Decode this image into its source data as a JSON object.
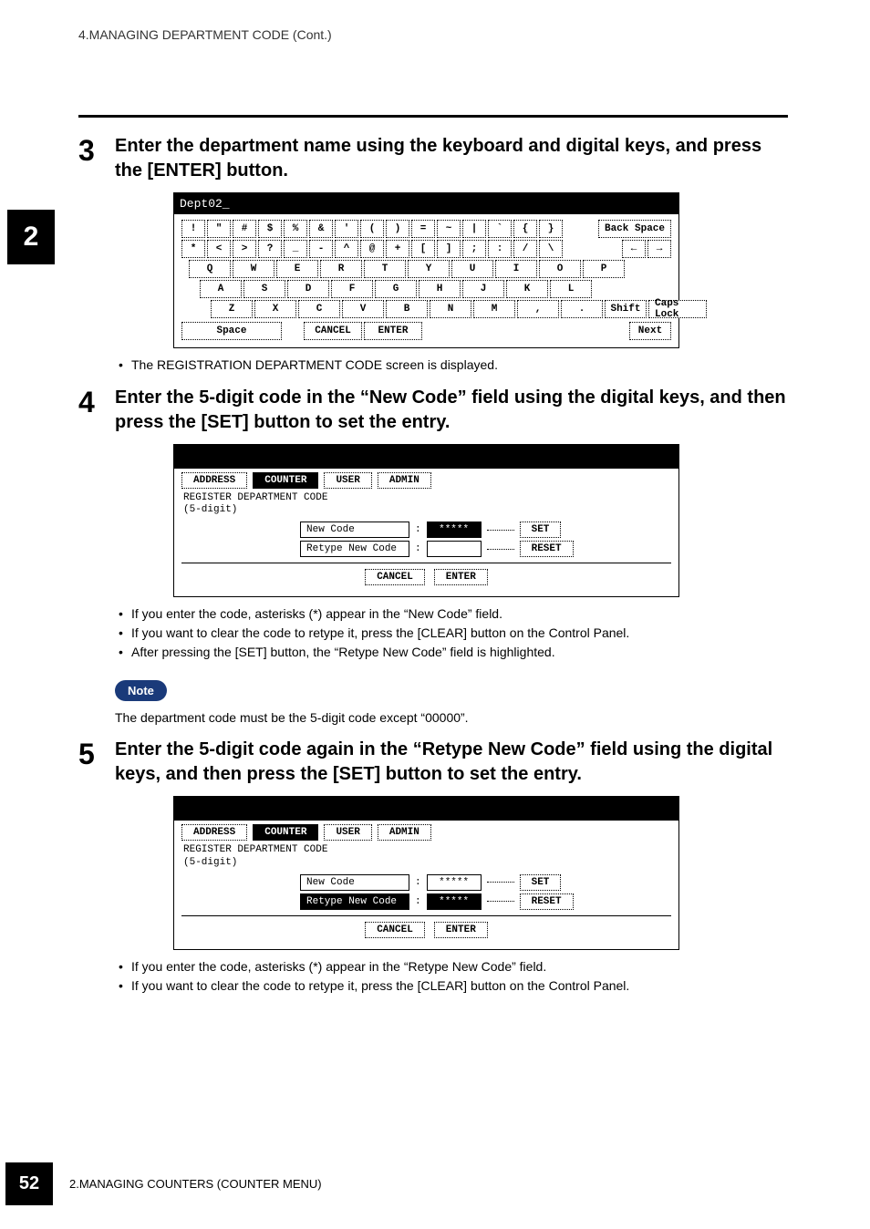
{
  "header_text": "4.MANAGING DEPARTMENT CODE (Cont.)",
  "side_tab": "2",
  "page_number": "52",
  "footer_text": "2.MANAGING COUNTERS (COUNTER MENU)",
  "steps": {
    "s3": {
      "num": "3",
      "heading": "Enter the department name using the keyboard and digital keys, and press the [ENTER] button.",
      "bullets": [
        "The REGISTRATION DEPARTMENT CODE screen is displayed."
      ]
    },
    "s4": {
      "num": "4",
      "heading": "Enter the 5-digit code in the “New Code” field using the digital keys, and then press the [SET] button to set the entry.",
      "bullets": [
        "If you enter the code, asterisks (*) appear in the “New Code” field.",
        "If you want to clear the code to retype it, press the [CLEAR] button on the Control Panel.",
        "After pressing the [SET] button, the “Retype New Code” field is highlighted."
      ]
    },
    "s5": {
      "num": "5",
      "heading": "Enter the 5-digit code again in the “Retype New Code” field using the digital keys, and then press the [SET] button to set the entry.",
      "bullets": [
        "If you enter the code, asterisks (*) appear in the “Retype New Code” field.",
        "If you want to clear the code to retype it, press the [CLEAR] button on the Control Panel."
      ]
    }
  },
  "note_label": "Note",
  "note_body": "The department code must be the 5-digit code except “00000”.",
  "keyboard": {
    "input_value": "Dept02_",
    "rows": {
      "r1": [
        "!",
        "\"",
        "#",
        "$",
        "%",
        "&",
        "'",
        "(",
        ")",
        "=",
        "~",
        "|",
        "`",
        "{",
        "}"
      ],
      "r2": [
        "*",
        "<",
        ">",
        "?",
        "_",
        "-",
        "^",
        "@",
        "+",
        "[",
        "]",
        ";",
        ":",
        "/",
        "\\"
      ],
      "r3": [
        "Q",
        "W",
        "E",
        "R",
        "T",
        "Y",
        "U",
        "I",
        "O",
        "P"
      ],
      "r4": [
        "A",
        "S",
        "D",
        "F",
        "G",
        "H",
        "J",
        "K",
        "L"
      ],
      "r5": [
        "Z",
        "X",
        "C",
        "V",
        "B",
        "N",
        "M",
        ",",
        "."
      ]
    },
    "back_space": "Back Space",
    "arrow_left": "←",
    "arrow_right": "→",
    "shift": "Shift",
    "caps_lock": "Caps Lock",
    "space": "Space",
    "cancel": "CANCEL",
    "enter": "ENTER",
    "next": "Next"
  },
  "counter_tabs": {
    "address": "ADDRESS",
    "counter": "COUNTER",
    "user": "USER",
    "admin": "ADMIN"
  },
  "counter_screen": {
    "title_line1": "REGISTER DEPARTMENT CODE",
    "title_line2": "(5-digit)",
    "new_code_label": "New Code",
    "retype_label": "Retype New Code",
    "masked": "*****",
    "colon": ":",
    "set": "SET",
    "reset": "RESET",
    "cancel": "CANCEL",
    "enter": "ENTER"
  }
}
